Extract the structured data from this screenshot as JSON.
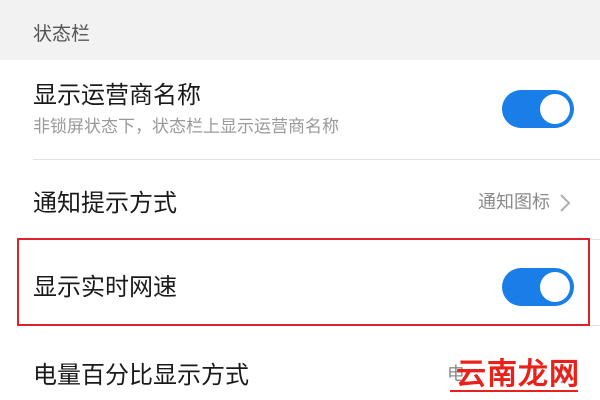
{
  "section": {
    "title": "状态栏"
  },
  "rows": [
    {
      "title": "显示运营商名称",
      "subtitle": "非锁屏状态下，状态栏上显示运营商名称",
      "toggle_on": true
    },
    {
      "title": "通知提示方式",
      "value": "通知图标"
    },
    {
      "title": "显示实时网速",
      "toggle_on": true
    },
    {
      "title": "电量百分比显示方式",
      "value": "电"
    }
  ],
  "watermark": {
    "text": "云南龙网"
  },
  "colors": {
    "accent": "#1a7ee8",
    "highlight": "#e0202a",
    "watermark": "#e8211a"
  },
  "icons": {
    "chevron": "chevron-right-icon"
  }
}
